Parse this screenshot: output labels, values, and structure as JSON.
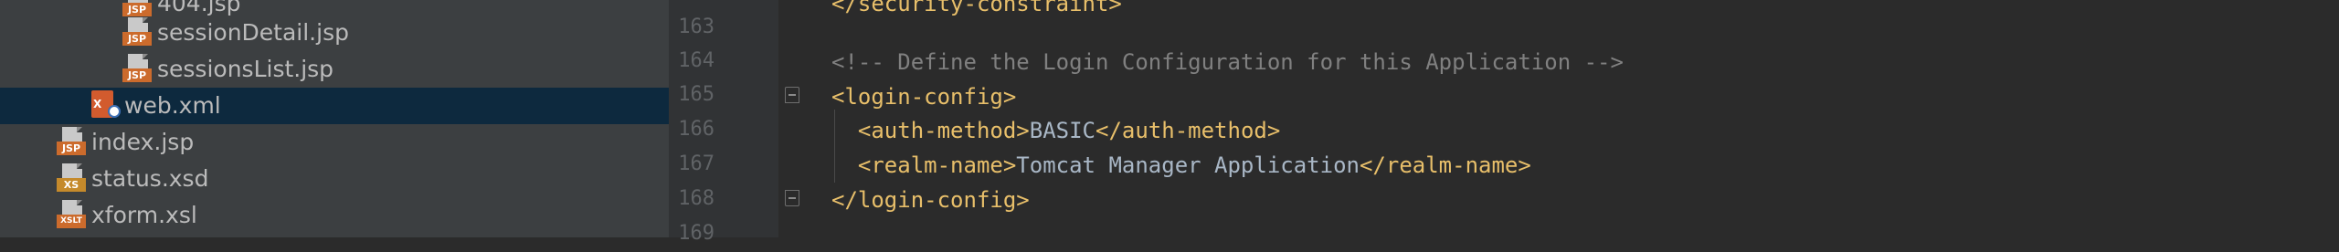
{
  "project_tree": {
    "items": [
      {
        "label": "404.jsp",
        "icon": "jsp-file-icon"
      },
      {
        "label": "sessionDetail.jsp",
        "icon": "jsp-file-icon"
      },
      {
        "label": "sessionsList.jsp",
        "icon": "jsp-file-icon"
      },
      {
        "label": "web.xml",
        "icon": "xml-config-file-icon",
        "selected": true
      },
      {
        "label": "index.jsp",
        "icon": "jsp-file-icon"
      },
      {
        "label": "status.xsd",
        "icon": "xsd-file-icon"
      },
      {
        "label": "xform.xsl",
        "icon": "xslt-file-icon"
      }
    ],
    "icon_tags": {
      "jsp": "JSP",
      "xsd": "XS",
      "xslt": "XSLT",
      "xml": "X"
    }
  },
  "editor": {
    "line_numbers": [
      "163",
      "164",
      "165",
      "166",
      "167",
      "168",
      "169"
    ],
    "lines": {
      "l164_comment": "<!-- Define the Login Configuration for this Application -->",
      "l165_open": "<login-config>",
      "l166_open": "<auth-method>",
      "l166_text": "BASIC",
      "l166_close": "</auth-method>",
      "l167_open": "<realm-name>",
      "l167_text": "Tomcat Manager Application",
      "l167_close": "</realm-name>",
      "l168_close": "</login-config>"
    },
    "colors": {
      "background": "#2b2b2b",
      "tag": "#e8bf6a",
      "comment": "#808080",
      "text": "#a9b7c6",
      "selection": "#0d293e"
    }
  }
}
